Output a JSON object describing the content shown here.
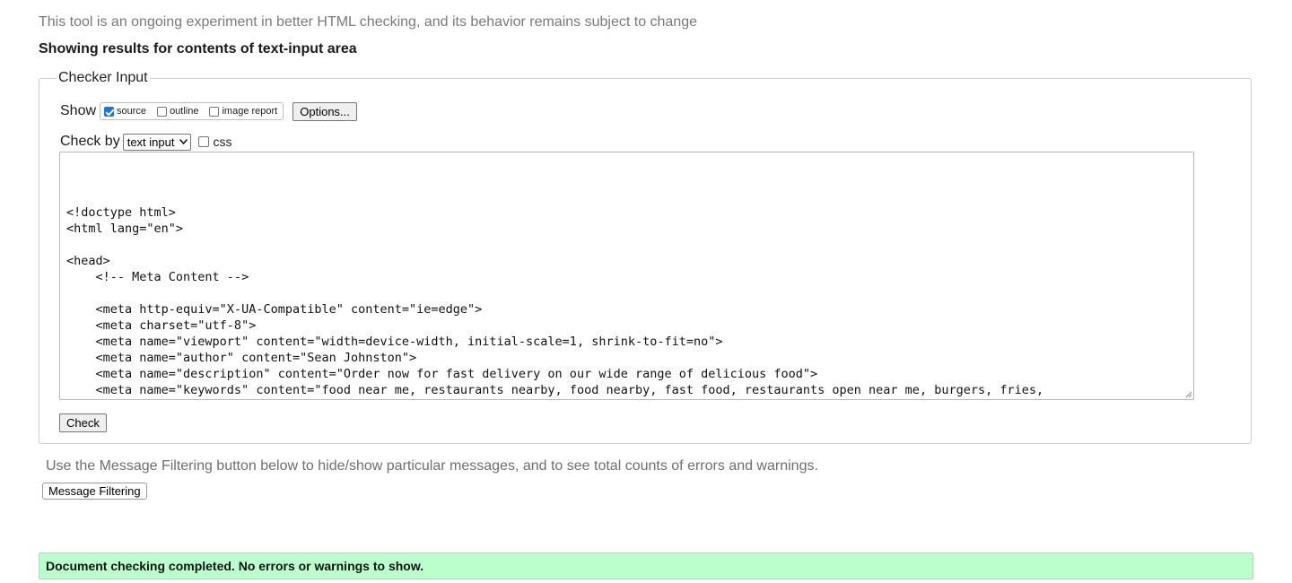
{
  "notice": "This tool is an ongoing experiment in better HTML checking, and its behavior remains subject to change",
  "results_heading": "Showing results for contents of text-input area",
  "checker": {
    "legend": "Checker Input",
    "show_label": "Show",
    "show_options": [
      {
        "label": "source",
        "checked": true
      },
      {
        "label": "outline",
        "checked": false
      },
      {
        "label": "image report",
        "checked": false
      }
    ],
    "options_button": "Options...",
    "check_by_label": "Check by",
    "check_by_value": "text input",
    "css_label": "css",
    "css_checked": false,
    "source_text": "<!doctype html>\n<html lang=\"en\">\n\n<head>\n    <!-- Meta Content -->\n\n    <meta http-equiv=\"X-UA-Compatible\" content=\"ie=edge\">\n    <meta charset=\"utf-8\">\n    <meta name=\"viewport\" content=\"width=device-width, initial-scale=1, shrink-to-fit=no\">\n    <meta name=\"author\" content=\"Sean Johnston\">\n    <meta name=\"description\" content=\"Order now for fast delivery on our wide range of delicious food\">\n    <meta name=\"keywords\" content=\"food near me, restaurants nearby, food nearby, fast food, restaurants open near me, burgers, fries,",
    "check_button": "Check"
  },
  "filter_note": "Use the Message Filtering button below to hide/show particular messages, and to see total counts of errors and warnings.",
  "filter_button": "Message Filtering",
  "status_message": "Document checking completed. No errors or warnings to show.",
  "colors": {
    "success_background": "#bbffcc",
    "checkbox_accent": "#1a73e8"
  }
}
